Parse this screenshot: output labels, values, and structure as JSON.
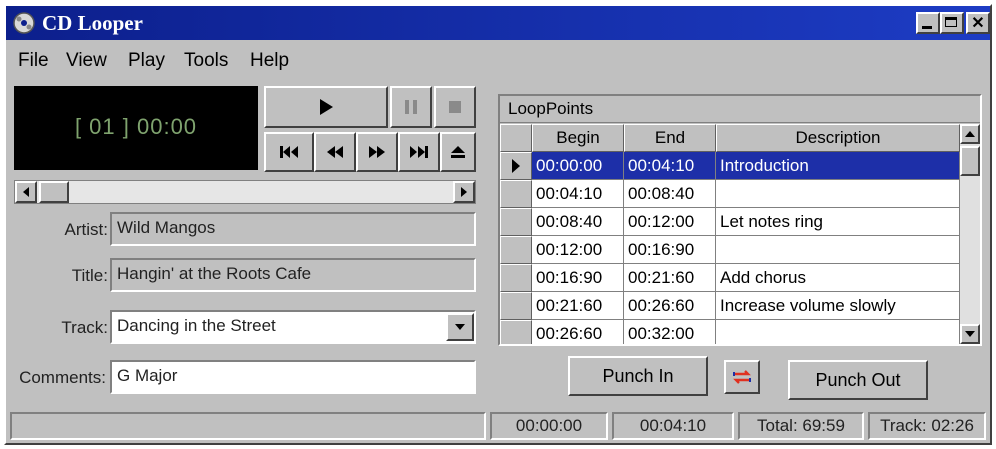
{
  "app": {
    "title": "CD Looper"
  },
  "menu": {
    "file": "File",
    "view": "View",
    "play": "Play",
    "tools": "Tools",
    "help": "Help"
  },
  "display": {
    "track_time": "[ 01 ]  00:00"
  },
  "fields": {
    "artist_label": "Artist:",
    "artist_value": "Wild Mangos",
    "title_label": "Title:",
    "title_value": "Hangin' at the Roots Cafe",
    "track_label": "Track:",
    "track_value": "Dancing in the Street",
    "comments_label": "Comments:",
    "comments_value": "G Major"
  },
  "loop_points": {
    "caption": "LoopPoints",
    "columns": [
      "Begin",
      "End",
      "Description"
    ],
    "rows": [
      {
        "begin": "00:00:00",
        "end": "00:04:10",
        "description": "Introduction"
      },
      {
        "begin": "00:04:10",
        "end": "00:08:40",
        "description": ""
      },
      {
        "begin": "00:08:40",
        "end": "00:12:00",
        "description": "Let notes ring"
      },
      {
        "begin": "00:12:00",
        "end": "00:16:90",
        "description": ""
      },
      {
        "begin": "00:16:90",
        "end": "00:21:60",
        "description": "Add chorus"
      },
      {
        "begin": "00:21:60",
        "end": "00:26:60",
        "description": "Increase volume slowly"
      },
      {
        "begin": "00:26:60",
        "end": "00:32:00",
        "description": ""
      }
    ]
  },
  "buttons": {
    "punch_in": "Punch In",
    "punch_out": "Punch Out"
  },
  "status": {
    "begin": "00:00:00",
    "end": "00:04:10",
    "total": "Total: 69:59",
    "track": "Track: 02:26"
  },
  "colors": {
    "title_bar": "#0c1f8c",
    "selection": "#1d2fa8",
    "lcd_text": "#7fa36e",
    "loop_icon": "#e03020"
  }
}
